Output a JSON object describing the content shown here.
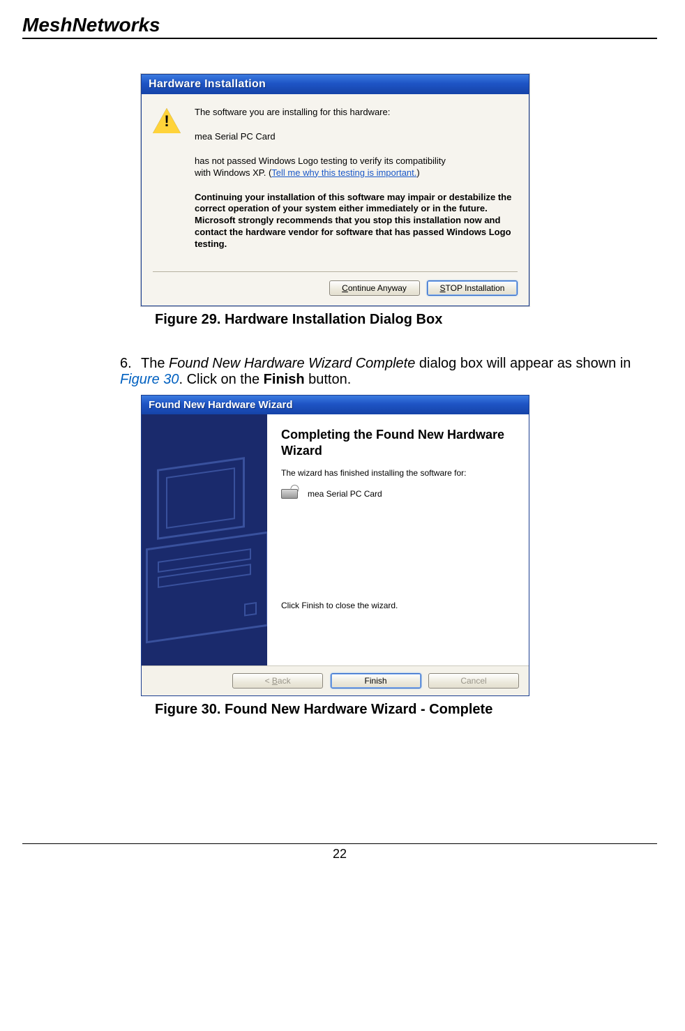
{
  "doc_header": "MeshNetworks",
  "figure29": {
    "caption": "Figure 29.      Hardware Installation Dialog Box",
    "title": "Hardware Installation",
    "line1": "The software you are installing for this hardware:",
    "hw_name": "mea Serial PC Card",
    "line2a": "has not passed Windows Logo testing to verify its compatibility",
    "line2b": "with Windows XP. (",
    "link": "Tell me why this testing is important.",
    "line2c": ")",
    "bold_text": "Continuing your installation of this software may impair or destabilize the correct operation of your system either immediately or in the future. Microsoft strongly recommends that you stop this installation now and contact the hardware vendor for software that has passed Windows Logo testing.",
    "btn_continue_pre": "C",
    "btn_continue_post": "ontinue Anyway",
    "btn_stop_pre": "S",
    "btn_stop_post": "TOP Installation"
  },
  "step6": {
    "num": "6.",
    "pre": "The ",
    "italic": "Found New Hardware Wizard Complete",
    "mid": " dialog box will appear as shown in ",
    "figref": "Figure 30",
    "post1": ".  Click on the ",
    "bold": "Finish",
    "post2": " button."
  },
  "figure30": {
    "caption": "Figure 30.      Found New Hardware Wizard - Complete",
    "title": "Found New Hardware Wizard",
    "heading": "Completing the Found New Hardware Wizard",
    "subtext": "The wizard has finished installing the software for:",
    "hw_name": "mea Serial PC Card",
    "finish_hint": "Click Finish to close the wizard.",
    "btn_back_pre": "< ",
    "btn_back_u": "B",
    "btn_back_post": "ack",
    "btn_finish": "Finish",
    "btn_cancel": "Cancel"
  },
  "page_number": "22"
}
